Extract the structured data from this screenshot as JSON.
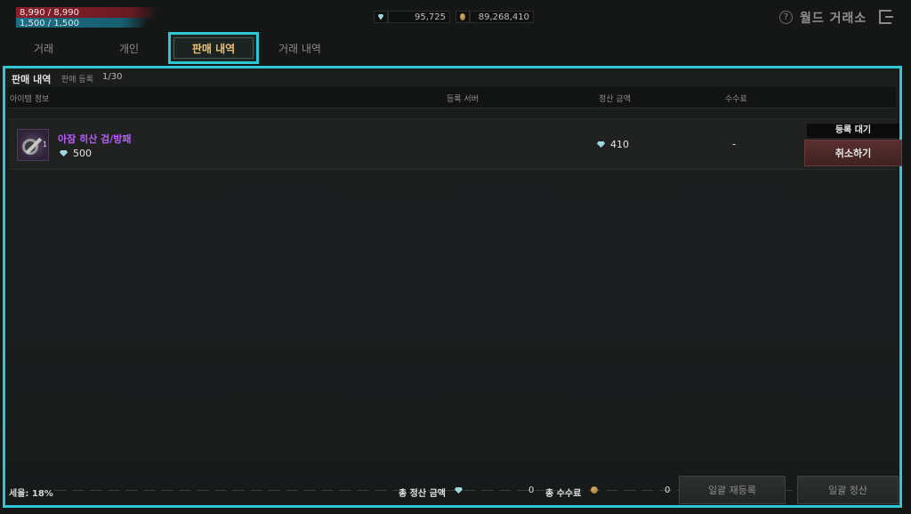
{
  "stats": {
    "hp": "8,990 / 8,990",
    "mp": "1,500 / 1,500"
  },
  "currency": {
    "gem_amount": "95,725",
    "gold_amount": "89,268,410"
  },
  "header": {
    "title": "월드 거래소",
    "help": "?"
  },
  "tabs": [
    {
      "label": "거래"
    },
    {
      "label": "개인"
    },
    {
      "label": "판매 내역"
    },
    {
      "label": "거래 내역"
    }
  ],
  "panel": {
    "title": "판매 내역",
    "subtitle": "판매 등록",
    "count": "1/30",
    "columns": {
      "item_info": "아이템 정보",
      "server": "등록 서버",
      "settle_amount": "정산 금액",
      "fee": "수수료"
    }
  },
  "rows": [
    {
      "name": "아잠 히산 검/방패",
      "badge": "1",
      "price": "500",
      "settle": "410",
      "fee": "-",
      "status": "등록 대기",
      "cancel": "취소하기"
    }
  ],
  "footer": {
    "tax": "세율: 18%",
    "total_settle_label": "총 정산 금액",
    "total_settle_value": "0",
    "total_fee_label": "총 수수료",
    "total_fee_value": "0",
    "bulk_reregister": "일괄 재등록",
    "bulk_settle": "일괄 정산"
  },
  "colors": {
    "accent": "#30c6d6",
    "item_name": "#b85cff",
    "active_tab": "#e7c27c"
  }
}
